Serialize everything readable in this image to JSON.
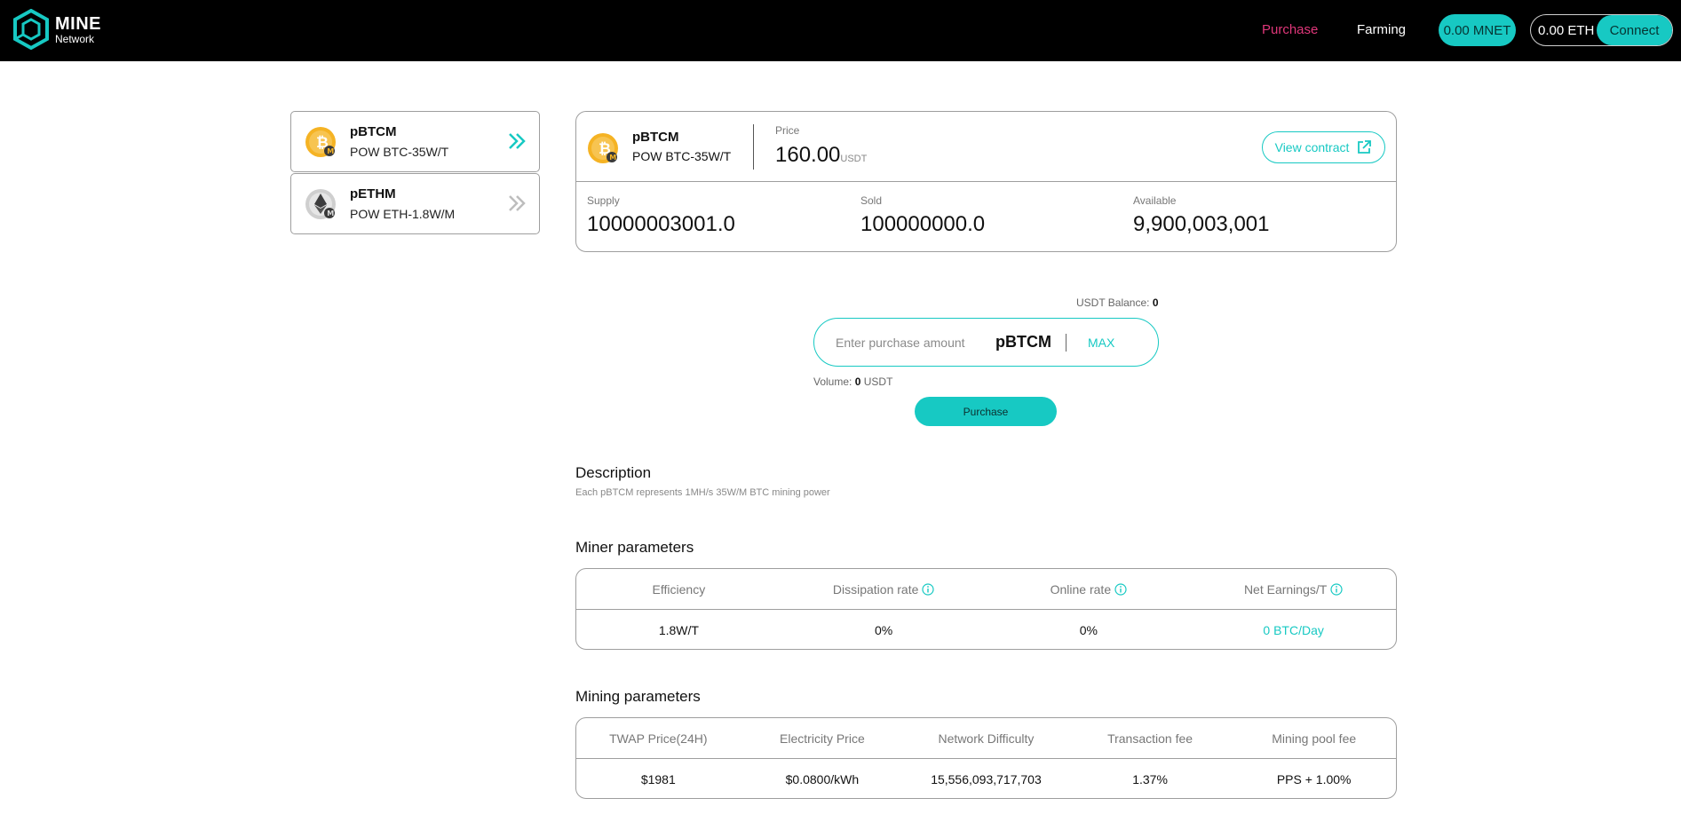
{
  "header": {
    "logo_line1": "MINE",
    "logo_line2": "Network",
    "nav_purchase": "Purchase",
    "nav_farming": "Farming",
    "mnet_balance": "0.00 MNET",
    "eth_balance": "0.00 ETH",
    "connect_label": "Connect"
  },
  "products": [
    {
      "name": "pBTCM",
      "sub": "POW BTC-35W/T",
      "icon": "bitcoin-coin-icon",
      "active": true
    },
    {
      "name": "pETHM",
      "sub": "POW ETH-1.8W/M",
      "icon": "ethereum-coin-icon",
      "active": false
    }
  ],
  "info": {
    "name": "pBTCM",
    "sub": "POW BTC-35W/T",
    "price_label": "Price",
    "price_value": "160.00",
    "price_unit": "USDT",
    "view_contract": "View contract",
    "supply_label": "Supply",
    "supply_value": "10000003001.0",
    "sold_label": "Sold",
    "sold_value": "100000000.0",
    "available_label": "Available",
    "available_value": "9,900,003,001"
  },
  "purchase": {
    "balance_label": "USDT Balance:",
    "balance_value": "0",
    "placeholder": "Enter purchase amount",
    "token": "pBTCM",
    "max_label": "MAX",
    "volume_label": "Volume:",
    "volume_value": "0",
    "volume_unit": "USDT",
    "button_label": "Purchase"
  },
  "description": {
    "title": "Description",
    "text": "Each pBTCM represents 1MH/s 35W/M BTC mining power"
  },
  "miner_params": {
    "title": "Miner parameters",
    "headers": [
      "Efficiency",
      "Dissipation rate",
      "Online rate",
      "Net Earnings/T"
    ],
    "values": [
      "1.8W/T",
      "0%",
      "0%",
      "0 BTC/Day"
    ]
  },
  "mining_params": {
    "title": "Mining parameters",
    "headers": [
      "TWAP Price(24H)",
      "Electricity Price",
      "Network Difficulty",
      "Transaction fee",
      "Mining pool fee"
    ],
    "values": [
      "$1981",
      "$0.0800/kWh",
      "15,556,093,717,703",
      "1.37%",
      "PPS + 1.00%"
    ]
  },
  "colors": {
    "accent": "#17c9c3",
    "nav_active": "#e0377a",
    "header_bg": "#000000"
  }
}
